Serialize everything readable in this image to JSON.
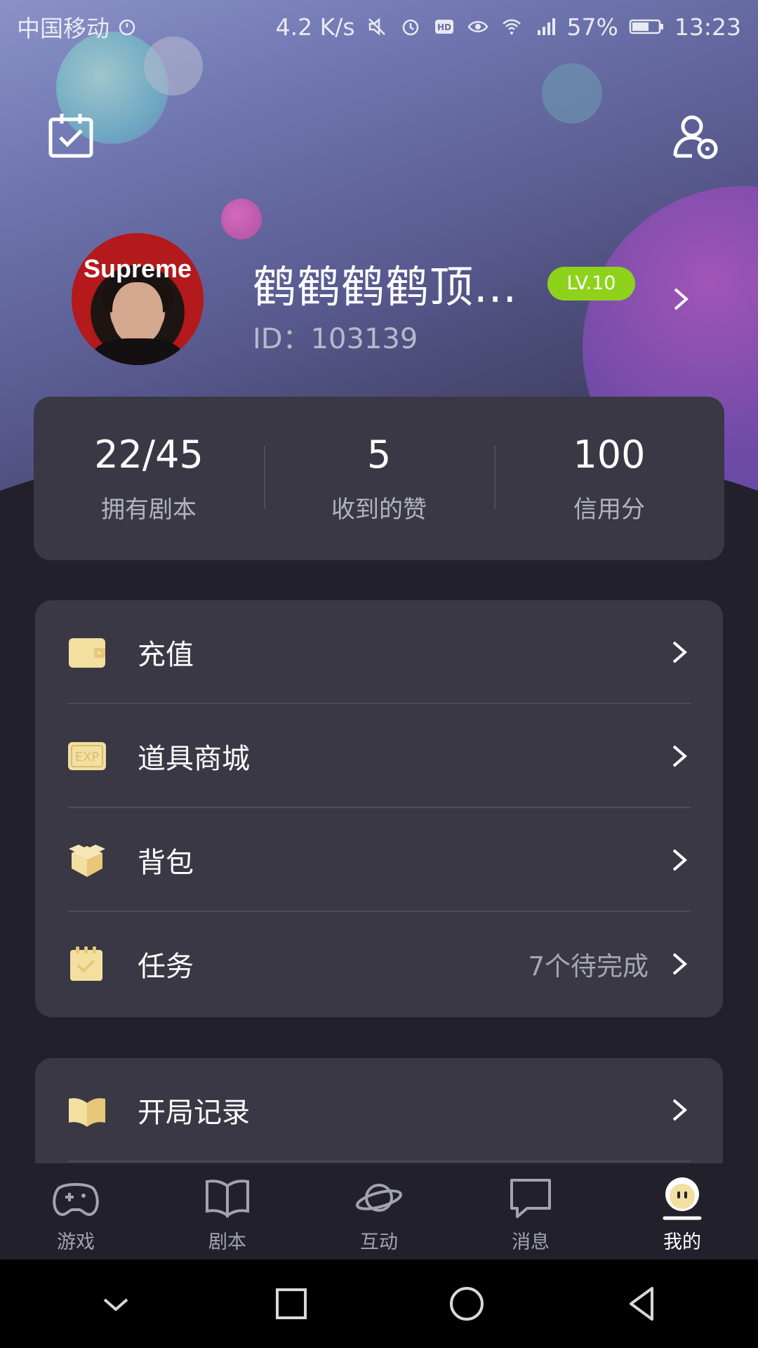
{
  "status_bar": {
    "carrier": "中国移动",
    "speed": "4.2 K/s",
    "battery": "57%",
    "time": "13:23"
  },
  "profile": {
    "name": "鹤鹤鹤鹤顶...",
    "id_text": "ID：103139",
    "level": "LV.10",
    "avatar_logo": "Supreme"
  },
  "stats": [
    {
      "value": "22/45",
      "label": "拥有剧本"
    },
    {
      "value": "5",
      "label": "收到的赞"
    },
    {
      "value": "100",
      "label": "信用分"
    }
  ],
  "menu": [
    {
      "label": "充值",
      "icon": "wallet-icon"
    },
    {
      "label": "道具商城",
      "icon": "exp-card-icon"
    },
    {
      "label": "背包",
      "icon": "box-icon"
    },
    {
      "label": "任务",
      "icon": "task-icon",
      "hint": "7个待完成"
    }
  ],
  "menu2": [
    {
      "label": "开局记录",
      "icon": "book-icon"
    }
  ],
  "tabs": [
    {
      "label": "游戏",
      "icon": "game-icon"
    },
    {
      "label": "剧本",
      "icon": "script-book-icon"
    },
    {
      "label": "互动",
      "icon": "planet-icon"
    },
    {
      "label": "消息",
      "icon": "message-icon"
    },
    {
      "label": "我的",
      "icon": "profile-face-icon",
      "active": true
    }
  ],
  "colors": {
    "background": "#22212b",
    "card": "#393844",
    "level_badge": "#8fd21c",
    "icon_gold": "#f3dfa0"
  }
}
